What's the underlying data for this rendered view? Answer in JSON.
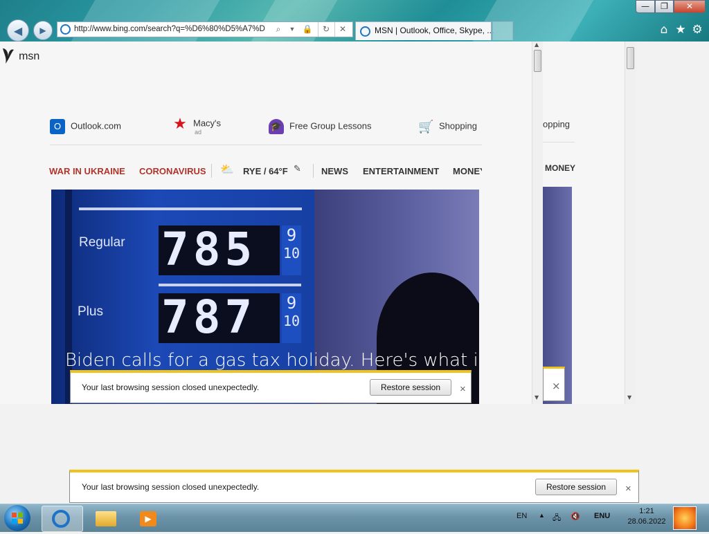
{
  "browser": {
    "back_icon": "back-arrow-icon",
    "forward_icon": "forward-arrow-icon",
    "address": "http://www.bing.com/search?q=%D6%80%D5%A7%D",
    "tab_title": "MSN | Outlook, Office, Skype, ...",
    "window_minimize": "—",
    "window_restore": "❐",
    "window_close": "✕"
  },
  "page": {
    "logo_text": "msn",
    "quick_links": [
      {
        "label": "Outlook.com",
        "sub": ""
      },
      {
        "label": "Macy's",
        "sub": "ad"
      },
      {
        "label": "Free Group Lessons",
        "sub": ""
      },
      {
        "label": "Shopping",
        "sub": ""
      }
    ],
    "nav": {
      "war": "WAR IN UKRAINE",
      "corona": "CORONAVIRUS",
      "weather": "RYE / 64°F",
      "news": "NEWS",
      "entertainment": "ENTERTAINMENT",
      "money": "MONEY"
    },
    "hero": {
      "headline": "Biden calls for a gas tax holiday. Here's what it r",
      "sign_regular": "Regular",
      "sign_plus": "Plus",
      "price_regular": "785",
      "price_plus": "787",
      "frac_num": "9",
      "frac_den": "10"
    },
    "side_peek": {
      "shopping": "opping",
      "money": "MONEY"
    }
  },
  "notifications": {
    "message": "Your last browsing session closed unexpectedly.",
    "restore_label": "Restore session",
    "close_glyph": "×"
  },
  "taskbar": {
    "lang": "EN",
    "input_lang": "ENU",
    "time": "1:21",
    "date": "28.06.2022"
  },
  "colors": {
    "accent_red": "#b0342b",
    "notif_yellow": "#f0c31c",
    "link_blue": "#0a6cbf"
  }
}
